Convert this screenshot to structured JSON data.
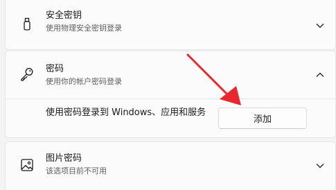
{
  "cards": {
    "security_key": {
      "title": "安全密钥",
      "subtitle": "使用物理安全密钥登录",
      "icon": "usb-key-icon"
    },
    "password": {
      "title": "密码",
      "subtitle": "使用你的帐户密码登录",
      "icon": "key-icon",
      "expanded": true,
      "body_text": "使用密码登录到 Windows、应用和服务",
      "add_button_label": "添加"
    },
    "picture_password": {
      "title": "图片密码",
      "subtitle": "该选项目前不可用",
      "icon": "picture-icon"
    }
  },
  "annotation": {
    "arrow_color": "#e8282e"
  }
}
